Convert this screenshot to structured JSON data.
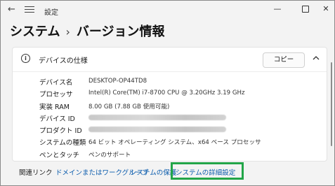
{
  "window": {
    "title": "設定"
  },
  "header": {
    "crumb_parent": "システム",
    "crumb_separator": "›",
    "crumb_current": "バージョン情報"
  },
  "device_card": {
    "title": "デバイスの仕様",
    "copy_button": "コピー",
    "specs": [
      {
        "key": "デバイス名",
        "value": "DESKTOP-OP44TD8"
      },
      {
        "key": "プロセッサ",
        "value": "Intel(R) Core(TM) i7-8700 CPU @ 3.20GHz   3.19 GHz"
      },
      {
        "key": "実装 RAM",
        "value": "8.00 GB (7.88 GB 使用可能)"
      },
      {
        "key": "デバイス ID",
        "value": ""
      },
      {
        "key": "プロダクト ID",
        "value": ""
      },
      {
        "key": "システムの種類",
        "value": "64 ビット オペレーティング システム、x64 ベース プロセッサ"
      },
      {
        "key": "ペンとタッチ",
        "value": "ペンのサポート"
      }
    ]
  },
  "related_links": {
    "label": "関連リンク",
    "links": [
      "ドメインまたはワークグループ",
      "システムの保護",
      "システムの詳細設定"
    ]
  },
  "colors": {
    "link": "#0b5cad",
    "highlight_box": "#22a548"
  }
}
